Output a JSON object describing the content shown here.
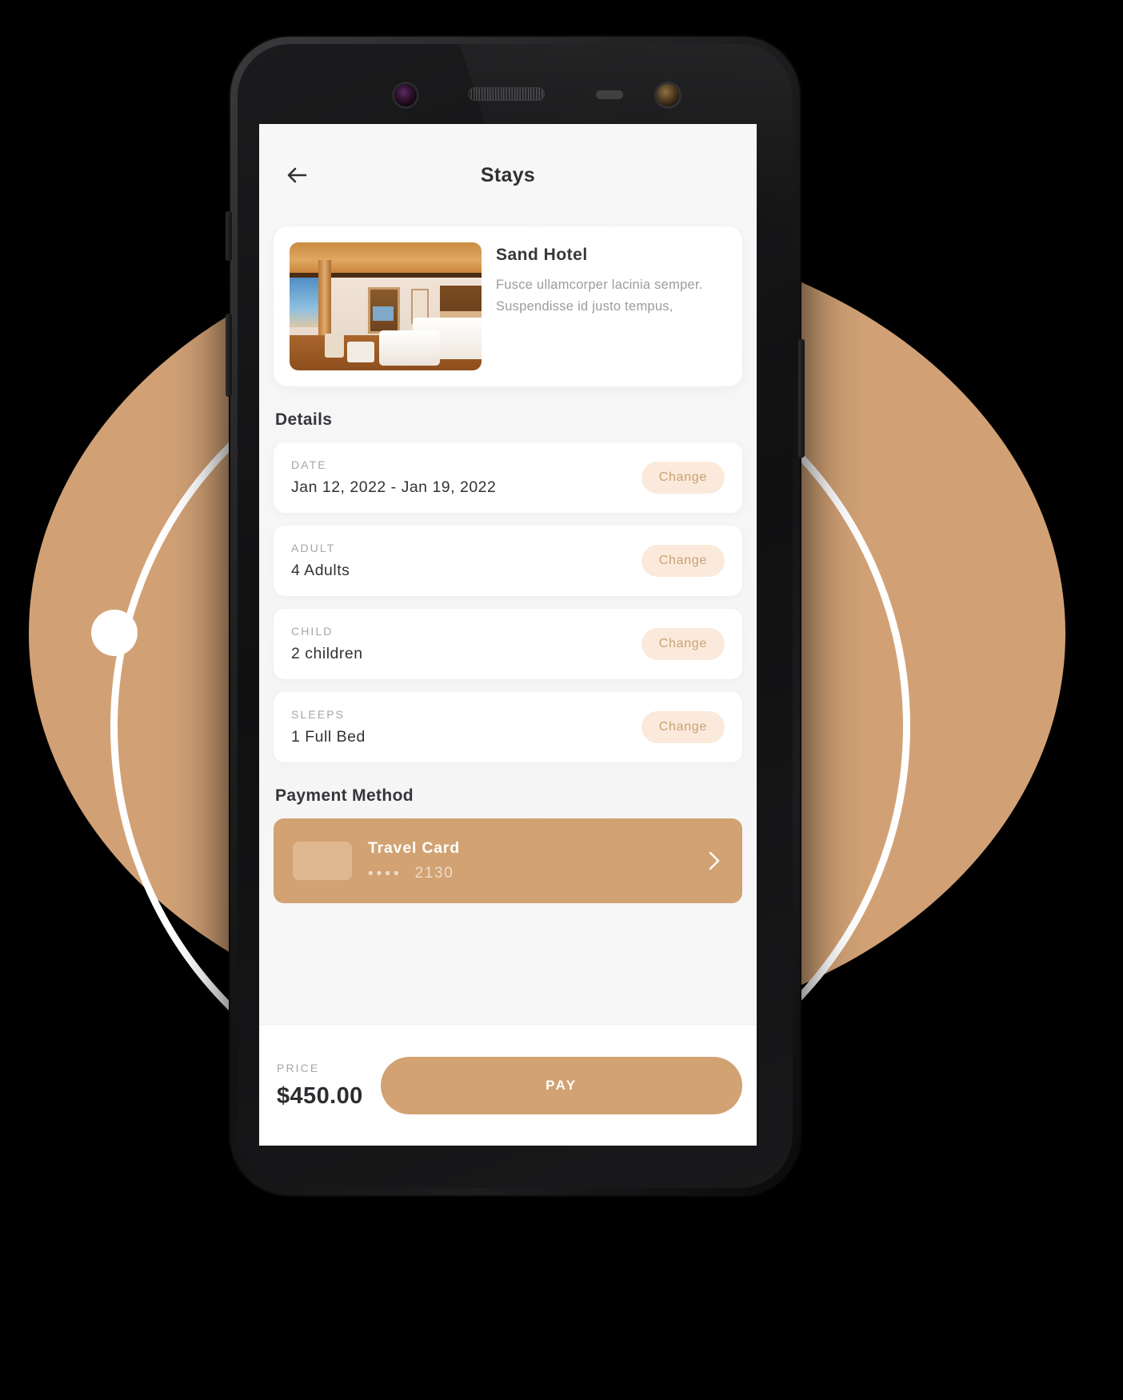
{
  "app": {
    "screen_title": "Stays",
    "back_icon": "arrow-left-icon"
  },
  "hotel": {
    "name": "Sand Hotel",
    "description": "Fusce ullamcorper lacinia semper. Suspendisse id justo tempus,",
    "thumbnail_alt": "hotel-room-photo"
  },
  "details": {
    "heading": "Details",
    "rows": [
      {
        "label": "DATE",
        "value": "Jan 12, 2022 - Jan 19, 2022",
        "action": "Change"
      },
      {
        "label": "ADULT",
        "value": "4 Adults",
        "action": "Change"
      },
      {
        "label": "CHILD",
        "value": "2 children",
        "action": "Change"
      },
      {
        "label": "SLEEPS",
        "value": "1 Full Bed",
        "action": "Change"
      }
    ]
  },
  "payment": {
    "heading": "Payment Method",
    "card": {
      "name": "Travel Card",
      "mask": "••••",
      "last4": "2130",
      "chevron_icon": "chevron-right-icon",
      "chip_icon": "card-chip-icon"
    }
  },
  "checkout": {
    "price_label": "PRICE",
    "price_value": "$450.00",
    "pay_label": "PAY"
  },
  "colors": {
    "accent": "#d2a273",
    "accent_soft": "#fbeadb",
    "accent_text": "#c9a074",
    "backdrop_circle": "#d1a175",
    "screen_bg": "#f7f7f7",
    "card_bg": "#ffffff",
    "title_text": "#2f3033",
    "muted_text": "#a5a6aa"
  }
}
